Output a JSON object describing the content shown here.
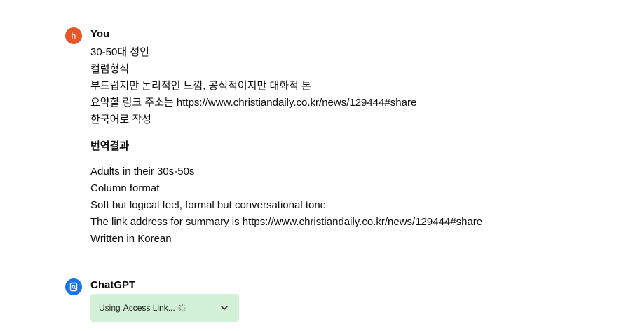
{
  "user": {
    "avatar_letter": "h",
    "avatar_color": "#e5562a",
    "name": "You",
    "lines": [
      "30-50대 성인",
      "컬럼형식",
      "부드럽지만 논리적인 느낌, 공식적이지만 대화적 톤",
      "요약할 링크 주소는 https://www.christiandaily.co.kr/news/129444#share",
      "한국어로 작성"
    ],
    "translation_heading": "번역결과",
    "translation_lines": [
      "Adults in their 30s-50s",
      "Column format",
      "Soft but logical feel, formal but conversational tone",
      "The link address for summary is https://www.christiandaily.co.kr/news/129444#share",
      "Written in Korean"
    ]
  },
  "assistant": {
    "name": "ChatGPT",
    "avatar_icon": "plugin-doc-icon",
    "avatar_color": "#1a73e8",
    "tool": {
      "prefix": "Using",
      "name": "Access Link...",
      "status_icon": "spinner-icon",
      "expand_icon": "chevron-down-icon",
      "bg_color": "#d3f1d6"
    }
  }
}
